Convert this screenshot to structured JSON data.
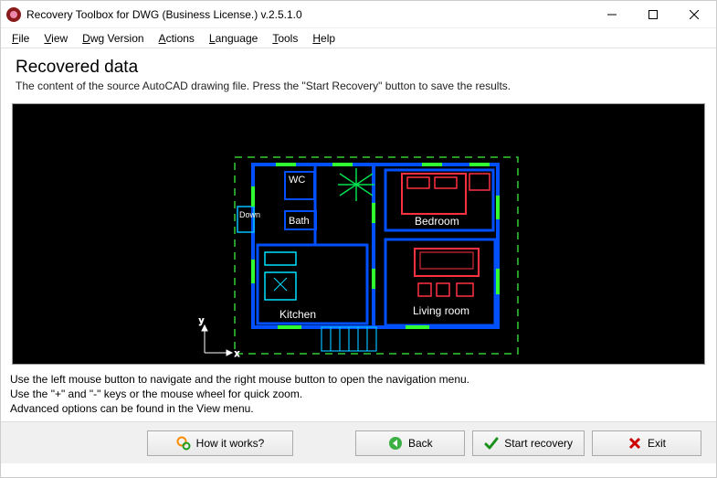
{
  "window": {
    "title": "Recovery Toolbox for DWG (Business License.) v.2.5.1.0"
  },
  "menu": {
    "file": "File",
    "view": "View",
    "dwg": "Dwg Version",
    "actions": "Actions",
    "language": "Language",
    "tools": "Tools",
    "help": "Help"
  },
  "header": {
    "title": "Recovered data",
    "subtitle": "The content of the source AutoCAD drawing file. Press the \"Start Recovery\" button to save the results."
  },
  "rooms": {
    "wc": "WC",
    "bath": "Bath",
    "bedroom": "Bedroom",
    "kitchen": "Kitchen",
    "living": "Living room",
    "down": "Down"
  },
  "axes": {
    "x": "x",
    "y": "y"
  },
  "hints": {
    "l1": "Use the left mouse button to navigate and the right mouse button to open the navigation menu.",
    "l2": "Use the \"+\" and \"-\" keys or the mouse wheel for quick zoom.",
    "l3": "Advanced options can be found in the View menu."
  },
  "buttons": {
    "how": "How it works?",
    "back": "Back",
    "start": "Start recovery",
    "exit": "Exit"
  }
}
